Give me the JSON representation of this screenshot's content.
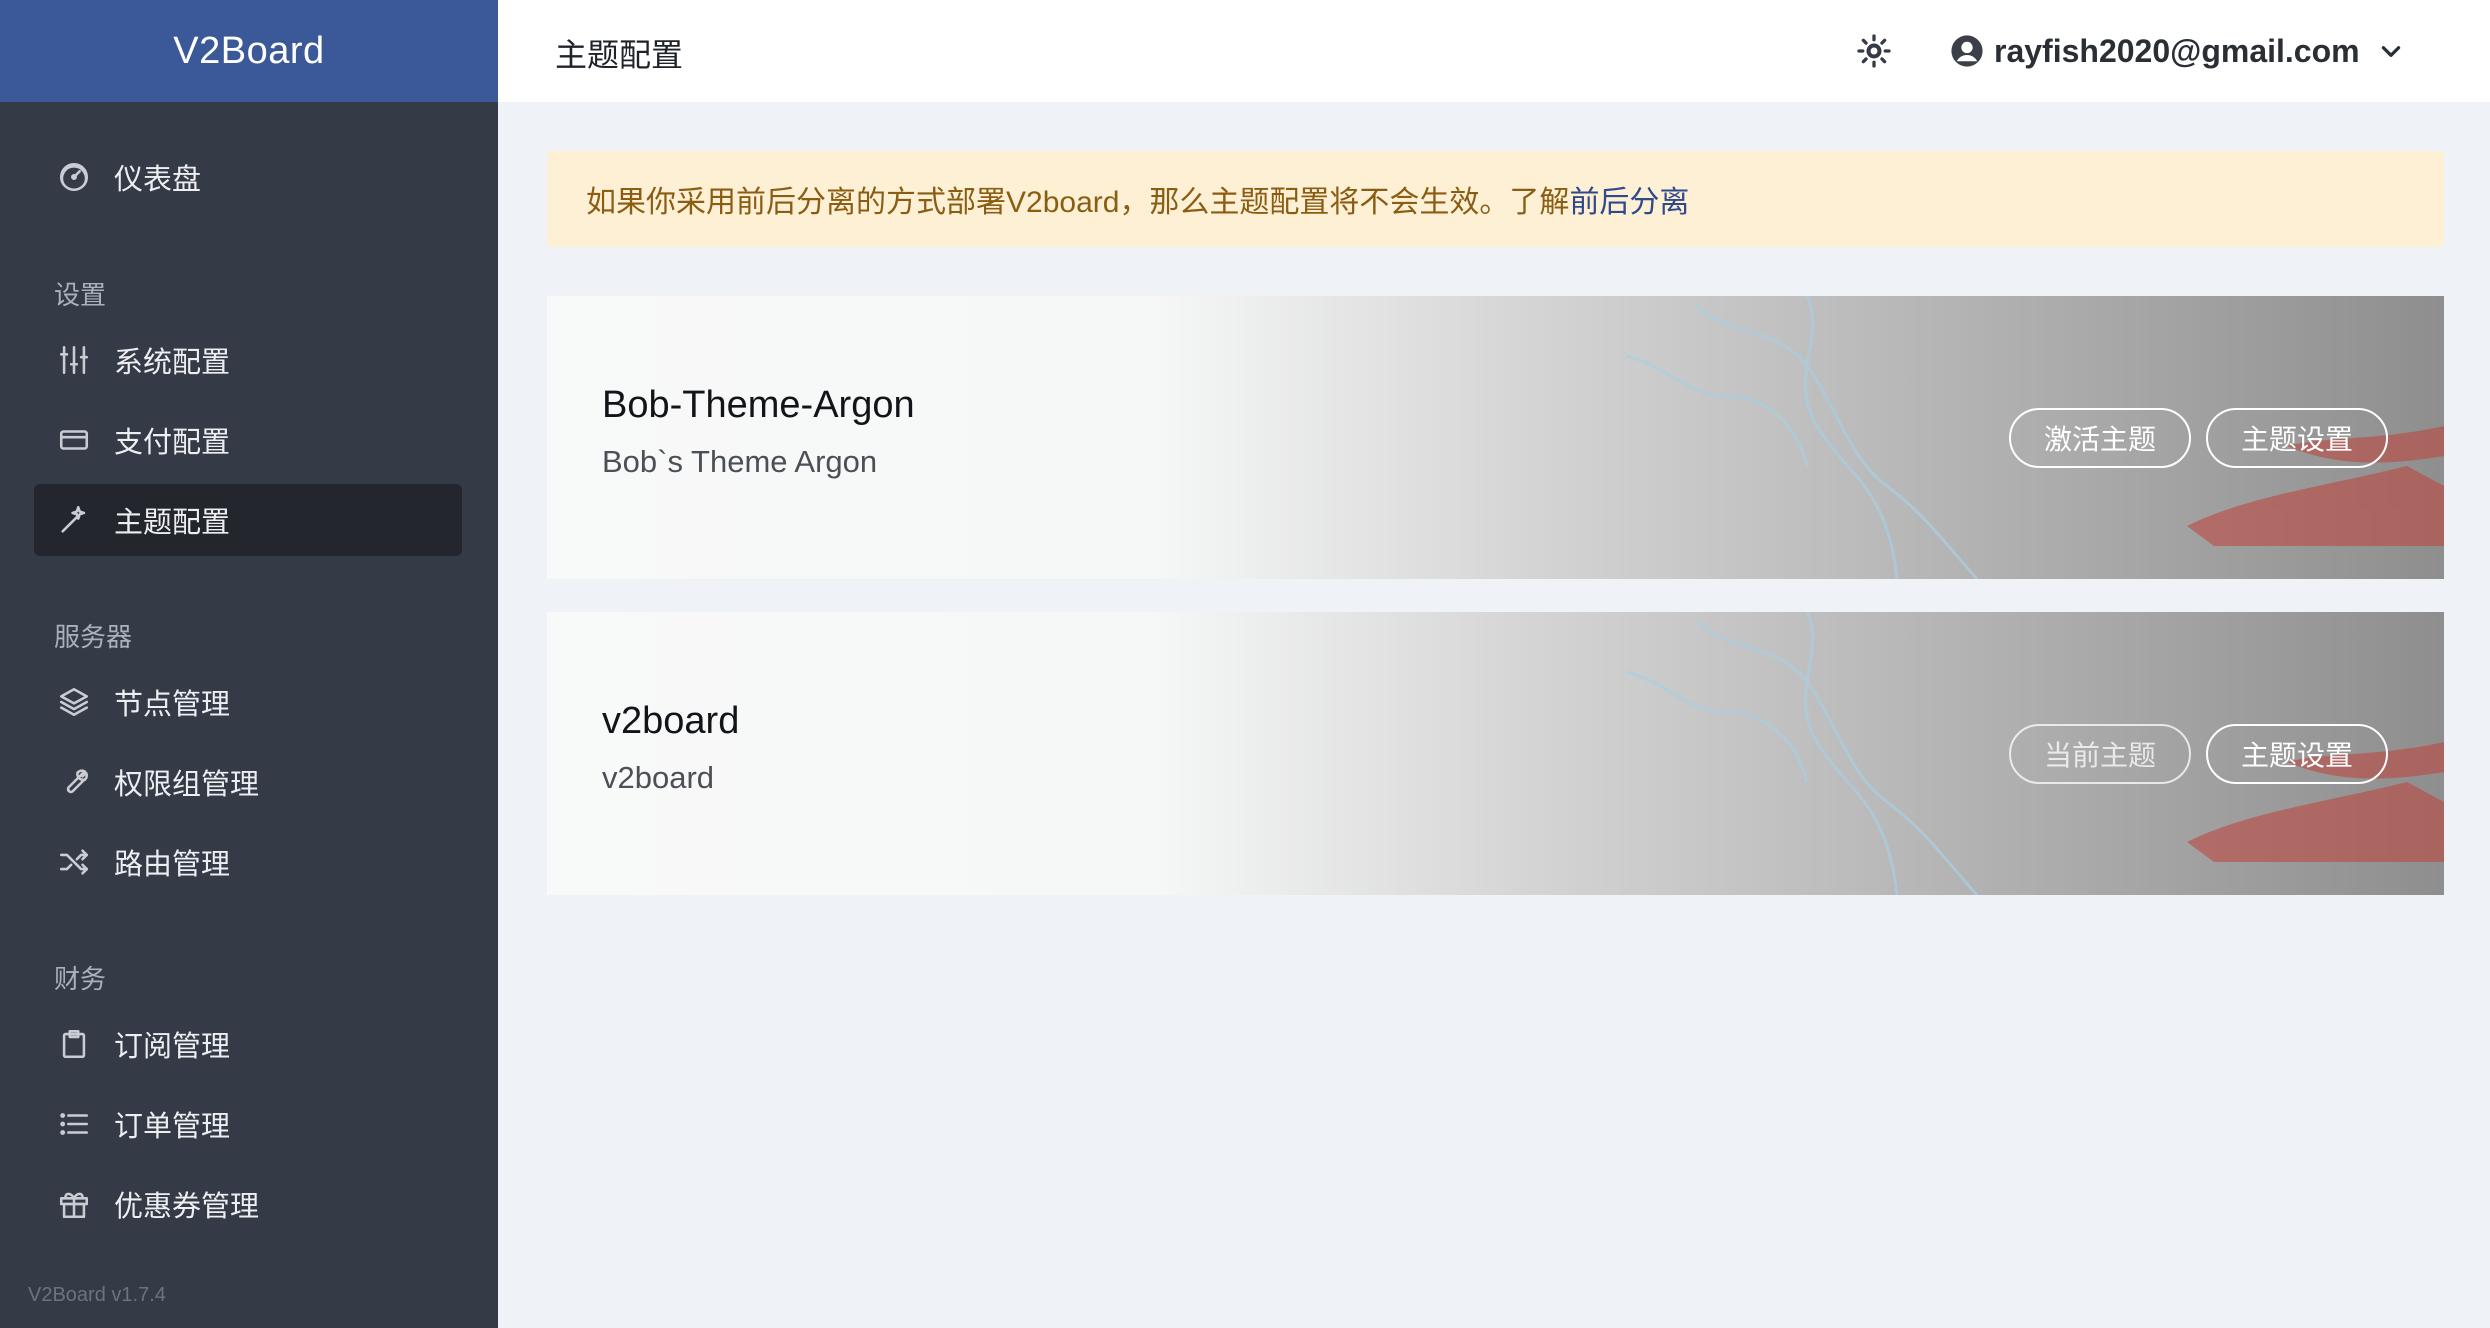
{
  "brand": {
    "name": "V2Board",
    "version": "V2Board v1.7.4"
  },
  "sidebar": {
    "items": [
      {
        "label": "仪表盘",
        "icon": "dashboard-icon"
      },
      {
        "heading": "设置"
      },
      {
        "label": "系统配置",
        "icon": "sliders-icon"
      },
      {
        "label": "支付配置",
        "icon": "credit-card-icon"
      },
      {
        "label": "主题配置",
        "icon": "magic-wand-icon",
        "active": true
      },
      {
        "heading": "服务器"
      },
      {
        "label": "节点管理",
        "icon": "layers-icon"
      },
      {
        "label": "权限组管理",
        "icon": "wrench-icon"
      },
      {
        "label": "路由管理",
        "icon": "shuffle-icon"
      },
      {
        "heading": "财务"
      },
      {
        "label": "订阅管理",
        "icon": "clipboard-icon"
      },
      {
        "label": "订单管理",
        "icon": "list-icon"
      },
      {
        "label": "优惠券管理",
        "icon": "gift-icon"
      }
    ]
  },
  "header": {
    "title": "主题配置",
    "theme_toggle_icon": "sun-icon",
    "user_email": "rayfish2020@gmail.com",
    "user_icon": "user-circle-icon",
    "dropdown_icon": "chevron-down-icon"
  },
  "alert": {
    "text": "如果你采用前后分离的方式部署V2board，那么主题配置将不会生效。了解",
    "link": "前后分离"
  },
  "themes": [
    {
      "name": "Bob-Theme-Argon",
      "description": "Bob`s Theme Argon",
      "primary_button": "激活主题",
      "settings_button": "主题设置",
      "current": false
    },
    {
      "name": "v2board",
      "description": "v2board",
      "primary_button": "当前主题",
      "settings_button": "主题设置",
      "current": true
    }
  ],
  "colors": {
    "brand": "#3b5998",
    "sidebar": "#343a46",
    "alert_bg": "#fdf0d5",
    "alert_text": "#8a5d13",
    "link": "#2f4a8a"
  }
}
